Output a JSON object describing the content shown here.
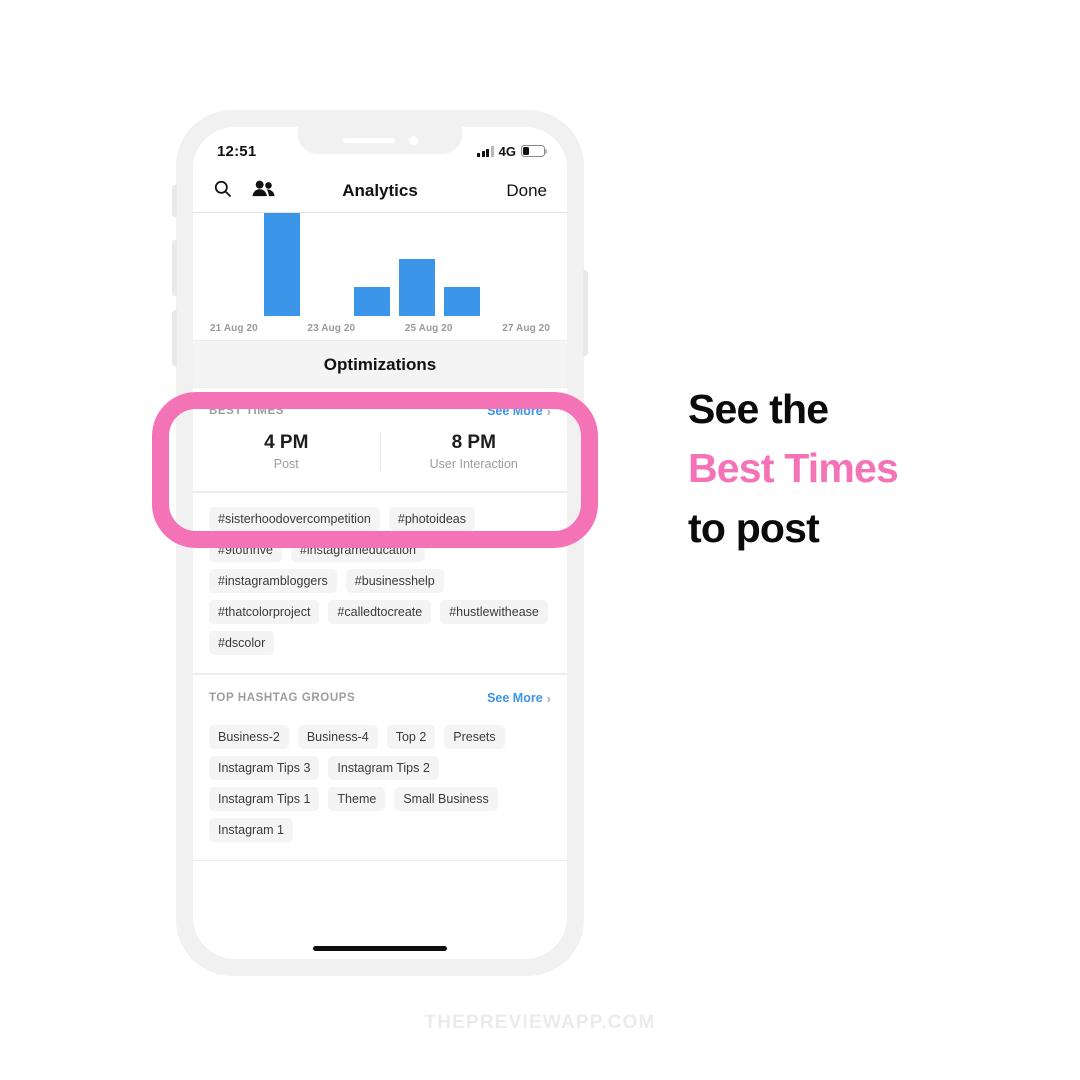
{
  "phone": {
    "status_bar": {
      "time": "12:51",
      "network": "4G",
      "signal_icon": "signal-bars-icon",
      "battery_icon": "battery-icon",
      "battery_level_pct": 30
    },
    "nav_bar": {
      "search_icon": "search-icon",
      "people_icon": "people-icon",
      "title": "Analytics",
      "done_label": "Done"
    },
    "home_indicator": "home-indicator"
  },
  "chart_data": {
    "type": "bar",
    "title": "",
    "xlabel": "",
    "ylabel": "",
    "tick_labels": [
      "21 Aug 20",
      "23 Aug 20",
      "25 Aug 20",
      "27 Aug 20"
    ],
    "categories": [
      "22 Aug 20",
      "24 Aug 20",
      "25 Aug 20",
      "26 Aug 20"
    ],
    "values": [
      100,
      28,
      55,
      28
    ],
    "ylim": [
      0,
      100
    ],
    "grid": false,
    "legend": false,
    "bar_color": "#3b95e8",
    "bars": [
      {
        "left_pct": 16.5,
        "width_pct": 10.5,
        "height_pct": 100
      },
      {
        "left_pct": 42.5,
        "width_pct": 10.5,
        "height_pct": 28
      },
      {
        "left_pct": 55.5,
        "width_pct": 10.5,
        "height_pct": 55
      },
      {
        "left_pct": 68.5,
        "width_pct": 10.5,
        "height_pct": 28
      }
    ]
  },
  "sections": {
    "optimizations_title": "Optimizations",
    "best_times": {
      "label": "BEST TIMES",
      "see_more": "See More",
      "chevron": "›",
      "columns": [
        {
          "time": "4 PM",
          "label": "Post"
        },
        {
          "time": "8 PM",
          "label": "User Interaction"
        }
      ]
    },
    "top_hashtags": {
      "chips": [
        "#sisterhoodovercompetition",
        "#photoideas",
        "#9tothrive",
        "#instagrameducation",
        "#instagrambloggers",
        "#businesshelp",
        "#thatcolorproject",
        "#calledtocreate",
        "#hustlewithease",
        "#dscolor"
      ]
    },
    "top_hashtag_groups": {
      "label": "TOP HASHTAG GROUPS",
      "see_more": "See More",
      "chevron": "›",
      "chips": [
        "Business-2",
        "Business-4",
        "Top 2",
        "Presets",
        "Instagram Tips 3",
        "Instagram Tips 2",
        "Instagram Tips 1",
        "Theme",
        "Small Business",
        "Instagram 1"
      ]
    }
  },
  "caption": {
    "line1": "See the",
    "line2": "Best Times",
    "line3": "to post",
    "highlight_color": "#F472B6"
  },
  "watermark": "THEPREVIEWAPP.COM"
}
